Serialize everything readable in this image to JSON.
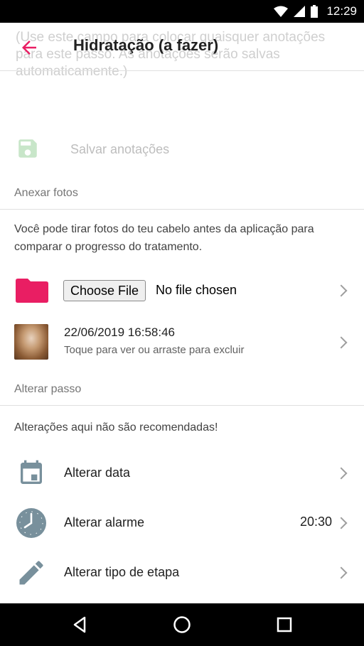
{
  "status_bar": {
    "time": "12:29"
  },
  "app_bar": {
    "title": "Hidratação (a fazer)",
    "back_icon": "arrow-back-icon",
    "accent_color": "#e91e63"
  },
  "ghost_notes": {
    "text": "(Use este campo para colocar quaisquer anotações para este passo. As anotações serão salvas automaticamente.)"
  },
  "save": {
    "label": "Salvar anotações",
    "icon": "floppy-disk-icon",
    "icon_color": "#c8e6c9"
  },
  "photos_section": {
    "header": "Anexar fotos",
    "info": "Você pode tirar fotos do teu cabelo antes da aplicação para comparar o progresso do tratamento.",
    "file_button": "Choose File",
    "file_status": "No file chosen",
    "folder_icon": "folder-icon",
    "photo_item": {
      "title": "22/06/2019 16:58:46",
      "subtitle": "Toque para ver ou arraste para excluir"
    }
  },
  "step_section": {
    "header": "Alterar passo",
    "info": "Alterações aqui não são recomendadas!",
    "items": [
      {
        "label": "Alterar data",
        "icon": "calendar-icon"
      },
      {
        "label": "Alterar alarme",
        "icon": "clock-icon",
        "value": "20:30"
      },
      {
        "label": "Alterar tipo de etapa",
        "icon": "pencil-icon"
      }
    ]
  },
  "nav_bar": {
    "buttons": [
      "back-triangle-icon",
      "home-circle-icon",
      "recents-square-icon"
    ]
  }
}
